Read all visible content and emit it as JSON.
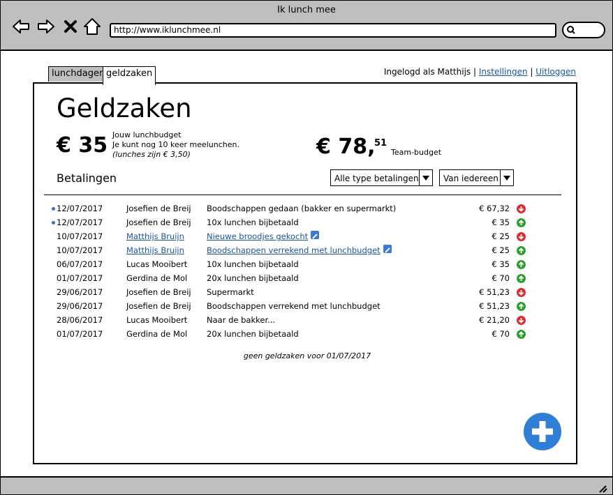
{
  "window": {
    "title": "Ik lunch mee"
  },
  "browser": {
    "url": "http://www.iklunchmee.nl"
  },
  "tabs": [
    {
      "label": "lunchdagen",
      "active": false
    },
    {
      "label": "geldzaken",
      "active": true
    }
  ],
  "userbar": {
    "logged_in": "Ingelogd als Matthijs",
    "sep1": "|",
    "settings": "Instellingen",
    "sep2": "|",
    "logout": "Uitloggen"
  },
  "page": {
    "title": "Geldzaken",
    "budget": {
      "amount": "€ 35",
      "label": "Jouw lunchbudget",
      "line2": "Je kunt nog 10 keer meelunchen.",
      "line3": "(lunches zijn € 3,50)"
    },
    "team": {
      "amount": "€ 78,",
      "cents": "51",
      "label": "Team-budget"
    },
    "section_title": "Betalingen",
    "filter_type": "Alle type betalingen",
    "filter_from": "Van iedereen",
    "footnote": "geen geldzaken voor 01/07/2017"
  },
  "payments": [
    {
      "date": "12/07/2017",
      "name": "Josefien de Breij",
      "desc": "Boodschappen gedaan (bakker en supermarkt)",
      "amount": "€ 67,32",
      "direction": "down",
      "new": true,
      "editable": false
    },
    {
      "date": "12/07/2017",
      "name": "Josefien de Breij",
      "desc": "10x lunchen bijbetaald",
      "amount": "€ 35",
      "direction": "up",
      "new": true,
      "editable": false
    },
    {
      "date": "10/07/2017",
      "name": "Matthijs Bruijn",
      "desc": "Nieuwe broodjes gekocht",
      "amount": "€ 25",
      "direction": "down",
      "new": false,
      "editable": true
    },
    {
      "date": "10/07/2017",
      "name": "Matthijs Bruijn",
      "desc": "Boodschappen verrekend met lunchbudget",
      "amount": "€ 25",
      "direction": "up",
      "new": false,
      "editable": true
    },
    {
      "date": "06/07/2017",
      "name": "Lucas Mooibert",
      "desc": "10x lunchen bijbetaald",
      "amount": "€ 35",
      "direction": "up",
      "new": false,
      "editable": false
    },
    {
      "date": "01/07/2017",
      "name": "Gerdina de Mol",
      "desc": "20x lunchen bijbetaald",
      "amount": "€ 70",
      "direction": "up",
      "new": false,
      "editable": false
    },
    {
      "date": "29/06/2017",
      "name": "Josefien de Breij",
      "desc": "Supermarkt",
      "amount": "€ 51,23",
      "direction": "down",
      "new": false,
      "editable": false
    },
    {
      "date": "29/06/2017",
      "name": "Josefien de Breij",
      "desc": "Boodschappen verrekend met lunchbudget",
      "amount": "€ 51,23",
      "direction": "up",
      "new": false,
      "editable": false
    },
    {
      "date": "28/06/2017",
      "name": "Lucas Mooibert",
      "desc": "Naar de bakker...",
      "amount": "€ 21,20",
      "direction": "down",
      "new": false,
      "editable": false
    },
    {
      "date": "01/07/2017",
      "name": "Gerdina de Mol",
      "desc": "20x lunchen bijbetaald",
      "amount": "€ 70",
      "direction": "up",
      "new": false,
      "editable": false
    }
  ],
  "icons": {
    "back": "back-arrow-icon",
    "forward": "forward-arrow-icon",
    "stop": "close-icon",
    "home": "home-icon",
    "search": "search-icon",
    "add": "plus-icon",
    "edit": "pencil-icon",
    "down": "arrow-down-icon",
    "up": "arrow-up-icon"
  },
  "colors": {
    "accent": "#2f7fd6",
    "link": "#1a56a0",
    "down": "#d63030",
    "up": "#2e9e2e",
    "chrome": "#bfbfbf"
  }
}
